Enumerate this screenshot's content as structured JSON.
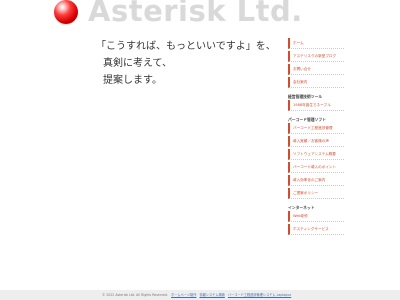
{
  "header": {
    "logo_text": "Asterisk Ltd."
  },
  "main": {
    "lines": [
      "「こうすれば、もっといいですよ」を、",
      "真剣に考えて、",
      "提案します。"
    ]
  },
  "sidebar": {
    "top_items": [
      {
        "label": "ホーム"
      },
      {
        "label": "アステリスクの新型ブログ"
      },
      {
        "label": "お問い合せ"
      },
      {
        "label": "会社案内"
      }
    ],
    "groups": [
      {
        "title": "経営管理技術ツール",
        "items": [
          {
            "label": "1988年誕生でネーブル"
          }
        ]
      },
      {
        "title": "パーコード管理ソフト",
        "items": [
          {
            "label": "バーコード工程進捗管理"
          },
          {
            "label": "導入実績／お客様の声"
          },
          {
            "label": "ソフトウェアシステム概要"
          },
          {
            "label": "バーコード導入のポイント"
          },
          {
            "label": "導入効率化のご案内"
          },
          {
            "label": "ご提案ポリシー"
          }
        ]
      },
      {
        "title": "インターネット",
        "items": [
          {
            "label": "Web制作"
          },
          {
            "label": "ホスティングサービス"
          }
        ]
      }
    ]
  },
  "footer": {
    "copyright": "© 2022 Asterisk Ltd. All Rights Reserved.",
    "links": [
      {
        "label": "ホームページ制作"
      },
      {
        "label": "情報システム構築"
      },
      {
        "label": "バーコード工程進捗管理システム Laplaque"
      }
    ]
  }
}
